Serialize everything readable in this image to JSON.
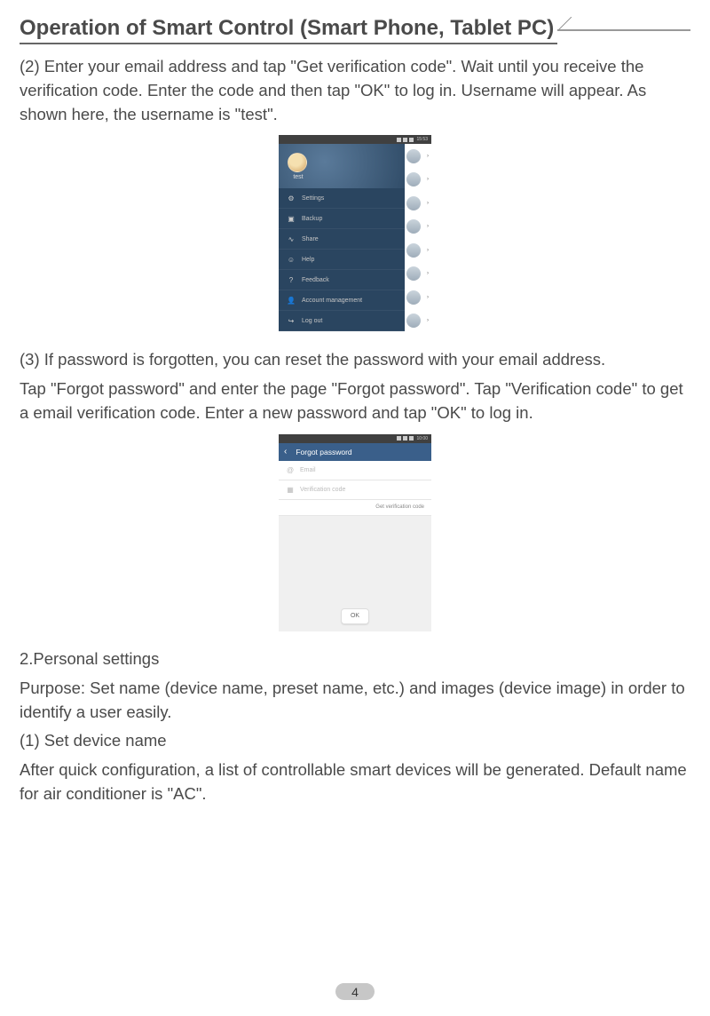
{
  "header": {
    "title": "Operation of Smart Control (Smart Phone, Tablet PC)"
  },
  "paragraphs": {
    "p1": "(2) Enter your email address and tap \"Get verification code\". Wait until you receive the verification code. Enter the code and then tap \"OK\" to log in. Username will appear. As shown here, the username is \"test\".",
    "p2": "(3) If password is forgotten, you can reset the password with your email address.",
    "p3": "Tap \"Forgot password\" and enter the page \"Forgot password\". Tap \"Verification code\" to get a email verification code. Enter a new password and tap \"OK\" to log in.",
    "p4": "2.Personal settings",
    "p5": "Purpose: Set name (device name, preset name, etc.) and images (device image) in order to identify a user easily.",
    "p6": "(1) Set device name",
    "p7": "After quick configuration, a list of controllable smart devices will be generated. Default name for air conditioner is \"AC\"."
  },
  "phone1": {
    "statusbar_time": "15:53",
    "username": "test",
    "menu": [
      {
        "icon": "⚙",
        "label": "Settings"
      },
      {
        "icon": "▣",
        "label": "Backup"
      },
      {
        "icon": "∿",
        "label": "Share"
      },
      {
        "icon": "☺",
        "label": "Help"
      },
      {
        "icon": "?",
        "label": "Feedback"
      },
      {
        "icon": "👤",
        "label": "Account management"
      },
      {
        "icon": "↪",
        "label": "Log out"
      }
    ]
  },
  "phone2": {
    "statusbar_time": "10:00",
    "header_title": "Forgot password",
    "email_placeholder": "Email",
    "code_placeholder": "Verification code",
    "get_code_label": "Get verification code",
    "ok_label": "OK"
  },
  "page_number": "4"
}
